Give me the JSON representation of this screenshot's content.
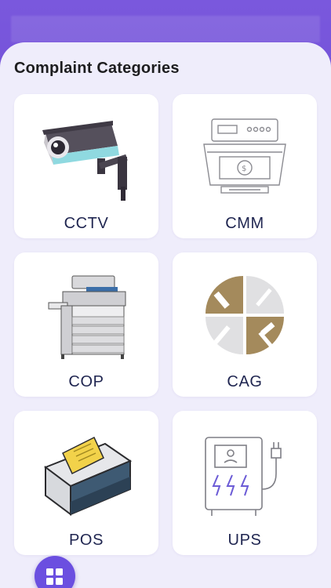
{
  "header": {
    "title": "Complaint Categories"
  },
  "categories": [
    {
      "label": "CCTV",
      "icon": "cctv-camera-icon"
    },
    {
      "label": "CMM",
      "icon": "cash-counting-machine-icon"
    },
    {
      "label": "COP",
      "icon": "copier-printer-icon"
    },
    {
      "label": "CAG",
      "icon": "tools-repair-icon"
    },
    {
      "label": "POS",
      "icon": "receipt-printer-icon"
    },
    {
      "label": "UPS",
      "icon": "power-supply-icon"
    }
  ],
  "nav": {
    "fab_icon": "grid-icon"
  },
  "colors": {
    "accent": "#6b4fe0",
    "background": "#efedfb",
    "card": "#ffffff"
  }
}
